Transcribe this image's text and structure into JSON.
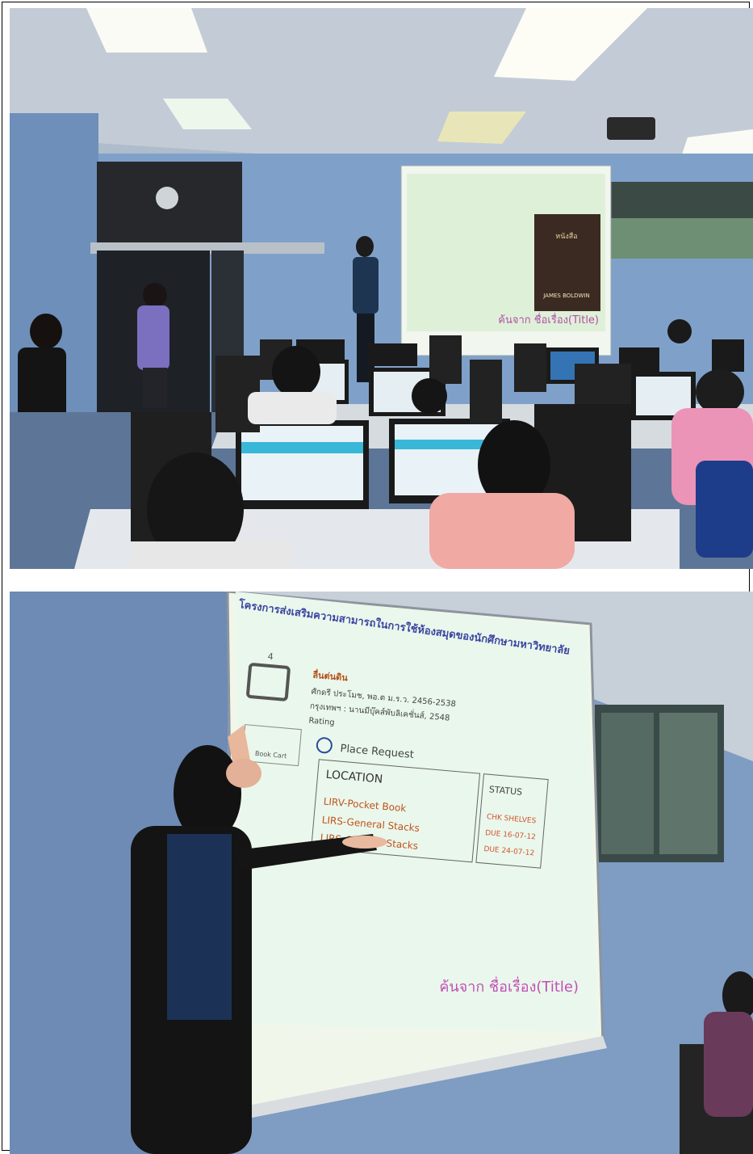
{
  "photo_top": {
    "caption_on_screen": "ค้นจาก ชื่อเรื่อง(Title)",
    "book_cover_text": "JAMES BOLDWIN"
  },
  "photo_bottom": {
    "slide_title": "โครงการส่งเสริมความสามารถในการใช้ห้องสมุดของนักศึกษามหาวิทยาลัย",
    "item_number": "4",
    "book_title": "ลื่นต่นดิน",
    "author_line": "ศักดรี ประโมช, พอ.ต ม.ร.ว. 2456-2538",
    "publisher_line": "กรุงเทพฯ : นานมีบุ๊คส์พับลิเคชั่นส์, 2548",
    "rating_label": "Rating",
    "book_cart_label": "Book Cart",
    "place_request_label": "Place Request",
    "location_header": "LOCATION",
    "status_header": "STATUS",
    "locations": [
      "LIRV-Pocket Book",
      "LIRS-General Stacks",
      "LIRS-General Stacks"
    ],
    "statuses": [
      "CHK SHELVES",
      "DUE 16-07-12",
      "DUE 24-07-12"
    ],
    "caption_on_screen": "ค้นจาก ชื่อเรื่อง(Title)"
  },
  "colors": {
    "wall": "#7f9fc6",
    "screen": "#eef6ea",
    "ceiling": "#c9d2dc"
  }
}
